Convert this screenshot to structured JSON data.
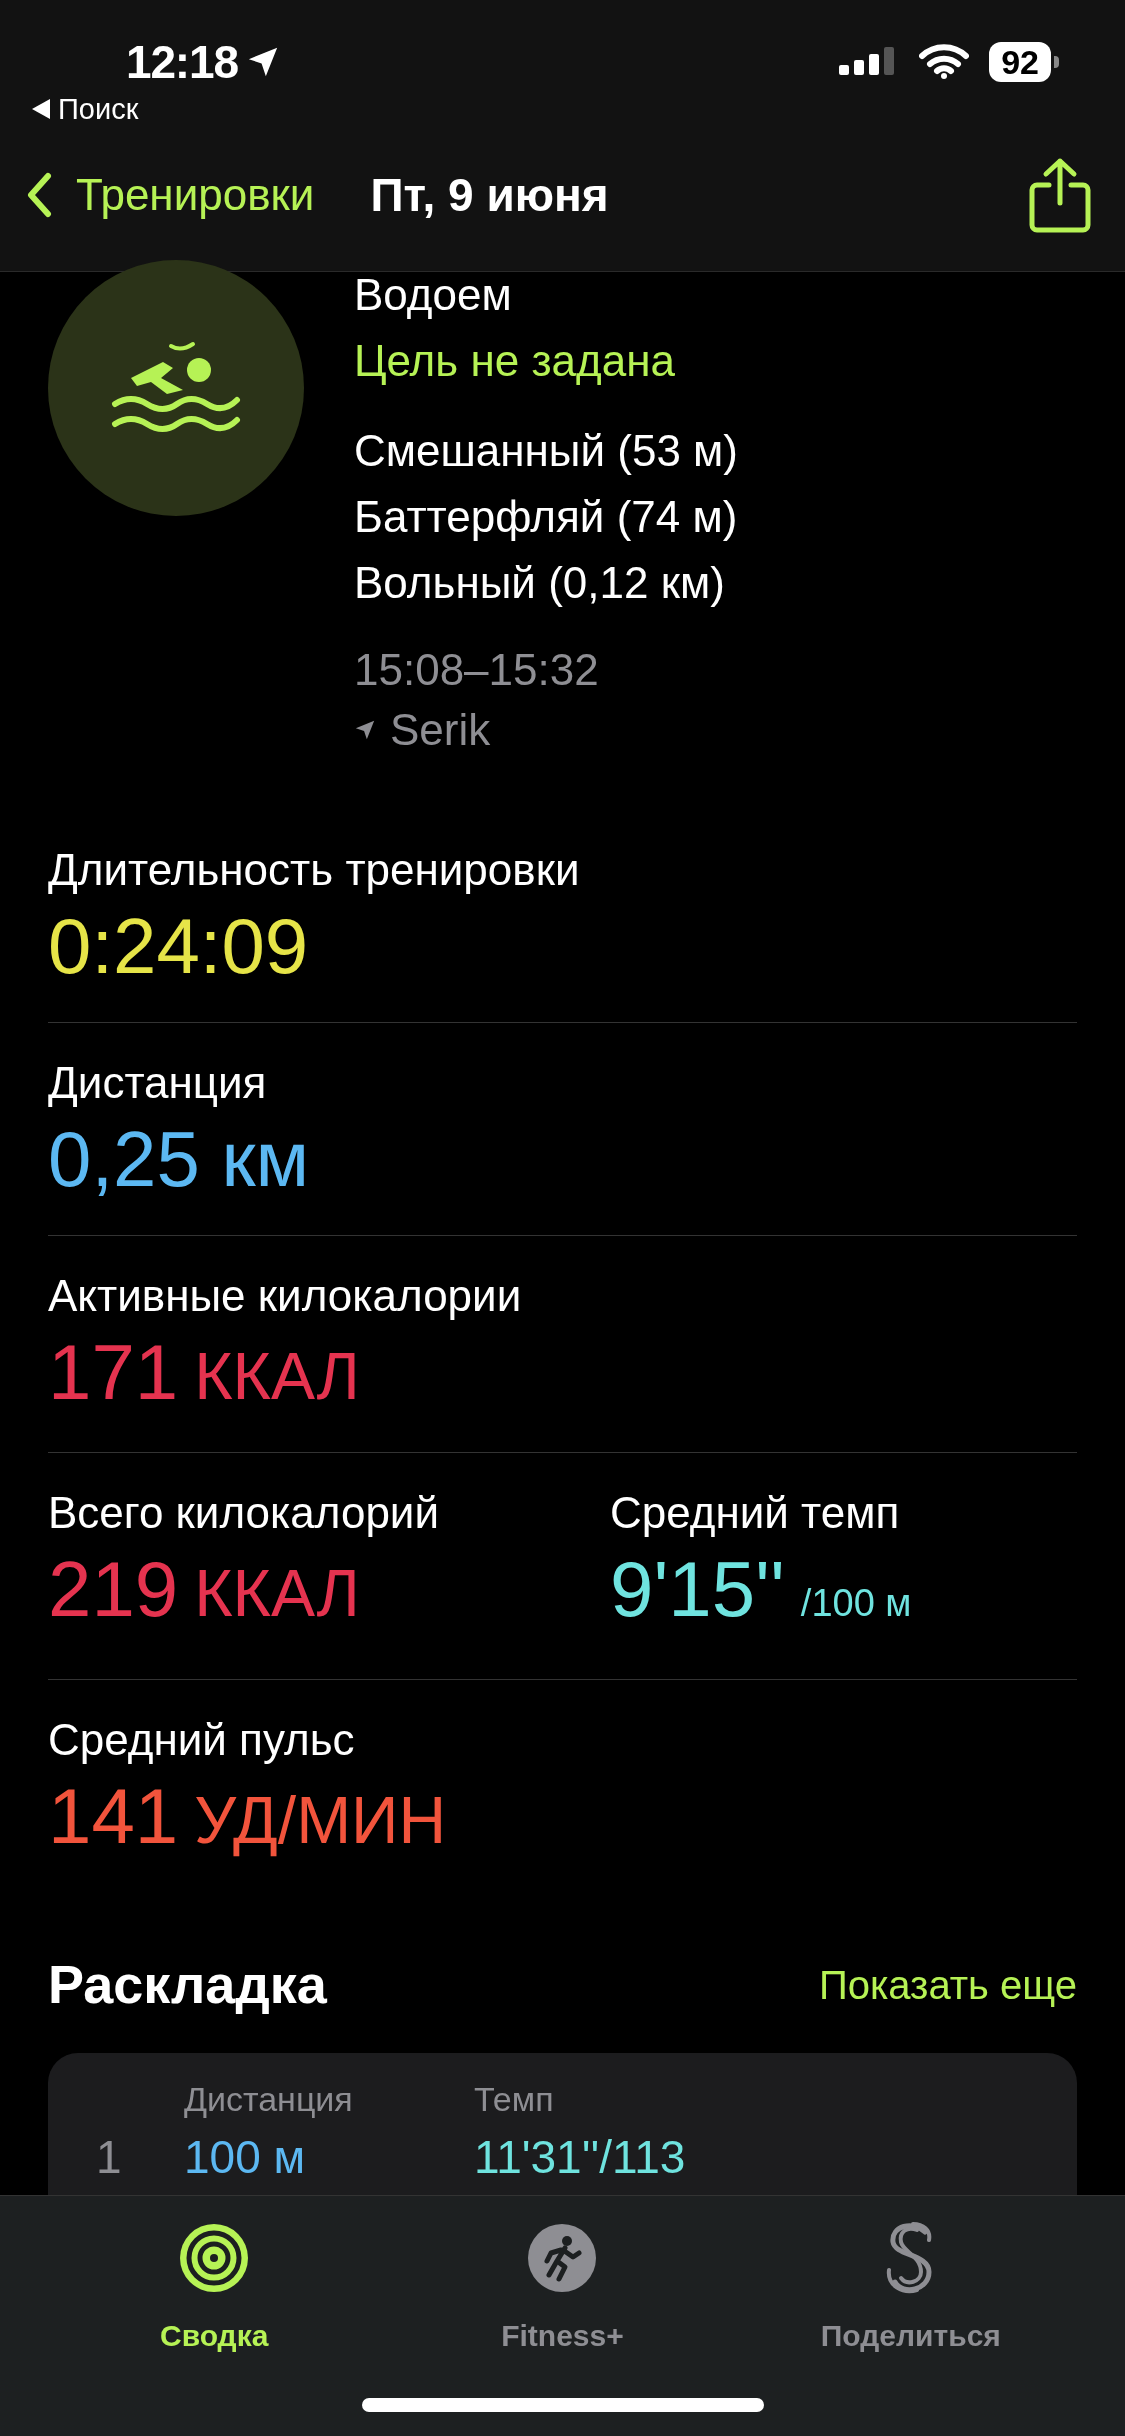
{
  "status_bar": {
    "time": "12:18",
    "back_link": "Поиск",
    "battery": "92"
  },
  "nav": {
    "back": "Тренировки",
    "title": "Пт, 9 июня"
  },
  "workout": {
    "name": "Водоем",
    "goal": "Цель не задана",
    "strokes": [
      "Смешанный (53 м)",
      "Баттерфляй (74 м)",
      "Вольный (0,12 км)"
    ],
    "time_range": "15:08–15:32",
    "location": "Serik"
  },
  "metrics": [
    {
      "items": [
        {
          "label": "Длительность тренировки",
          "value": "0:24:09",
          "color": "#e6e448"
        }
      ]
    },
    {
      "items": [
        {
          "label": "Дистанция",
          "value": "0,25 км",
          "color": "#5cb8f2"
        }
      ]
    },
    {
      "items": [
        {
          "label": "Активные килокалории",
          "value": "171",
          "unit": "ККАЛ",
          "color": "#e5334f"
        }
      ]
    },
    {
      "items": [
        {
          "label": "Всего килокалорий",
          "value": "219",
          "unit": "ККАЛ",
          "color": "#e5334f"
        },
        {
          "label": "Средний темп",
          "value": "9'15''",
          "unit": "/100 м",
          "color": "#6fe3df"
        }
      ]
    },
    {
      "items": [
        {
          "label": "Средний пульс",
          "value": "141",
          "unit": "УД/МИН",
          "color": "#f2543c"
        }
      ]
    }
  ],
  "splits": {
    "title": "Раскладка",
    "action": "Показать еще",
    "columns": [
      "Дистанция",
      "Темп"
    ],
    "rows": [
      {
        "index": "1",
        "distance": "100 м",
        "pace": "11'31''/113"
      }
    ]
  },
  "tabs": [
    {
      "label": "Сводка",
      "selected": true
    },
    {
      "label": "Fitness+",
      "selected": false
    },
    {
      "label": "Поделиться",
      "selected": false
    }
  ]
}
